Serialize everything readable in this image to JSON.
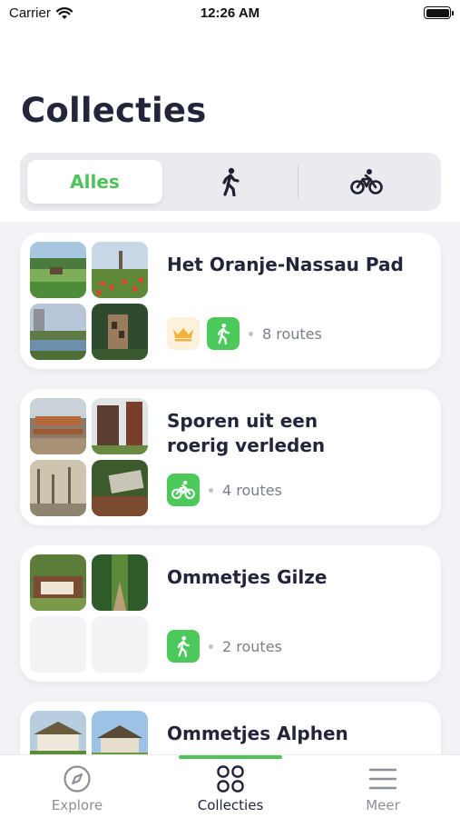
{
  "status_bar": {
    "carrier": "Carrier",
    "time": "12:26 AM",
    "icons": [
      "wifi-icon",
      "battery-icon"
    ]
  },
  "page_title": "Collecties",
  "filter": {
    "options": [
      {
        "label": "Alles",
        "selected": true
      },
      {
        "icon": "walking-icon",
        "selected": false
      },
      {
        "icon": "bicycle-icon",
        "selected": false
      }
    ]
  },
  "collections": [
    {
      "title": "Het Oranje-Nassau Pad",
      "badges": [
        "crown-icon",
        "walking-icon"
      ],
      "routes": "8 routes"
    },
    {
      "title_line1": "Sporen uit een",
      "title_line2": "roerig verleden",
      "badges": [
        "bicycle-icon"
      ],
      "routes": "4 routes"
    },
    {
      "title": "Ommetjes Gilze",
      "badges": [
        "walking-icon"
      ],
      "routes": "2 routes"
    },
    {
      "title": "Ommetjes Alphen"
    }
  ],
  "tab_bar": {
    "tabs": [
      {
        "label": "Explore",
        "icon": "compass-icon",
        "active": false
      },
      {
        "label": "Collecties",
        "icon": "grid-icon",
        "active": true
      },
      {
        "label": "Meer",
        "icon": "menu-icon",
        "active": false
      }
    ]
  },
  "colors": {
    "accent_green": "#4fc35b",
    "title_dark": "#23253a",
    "background_gray": "#f3f3f7",
    "crown_gold": "#f2b33d"
  }
}
